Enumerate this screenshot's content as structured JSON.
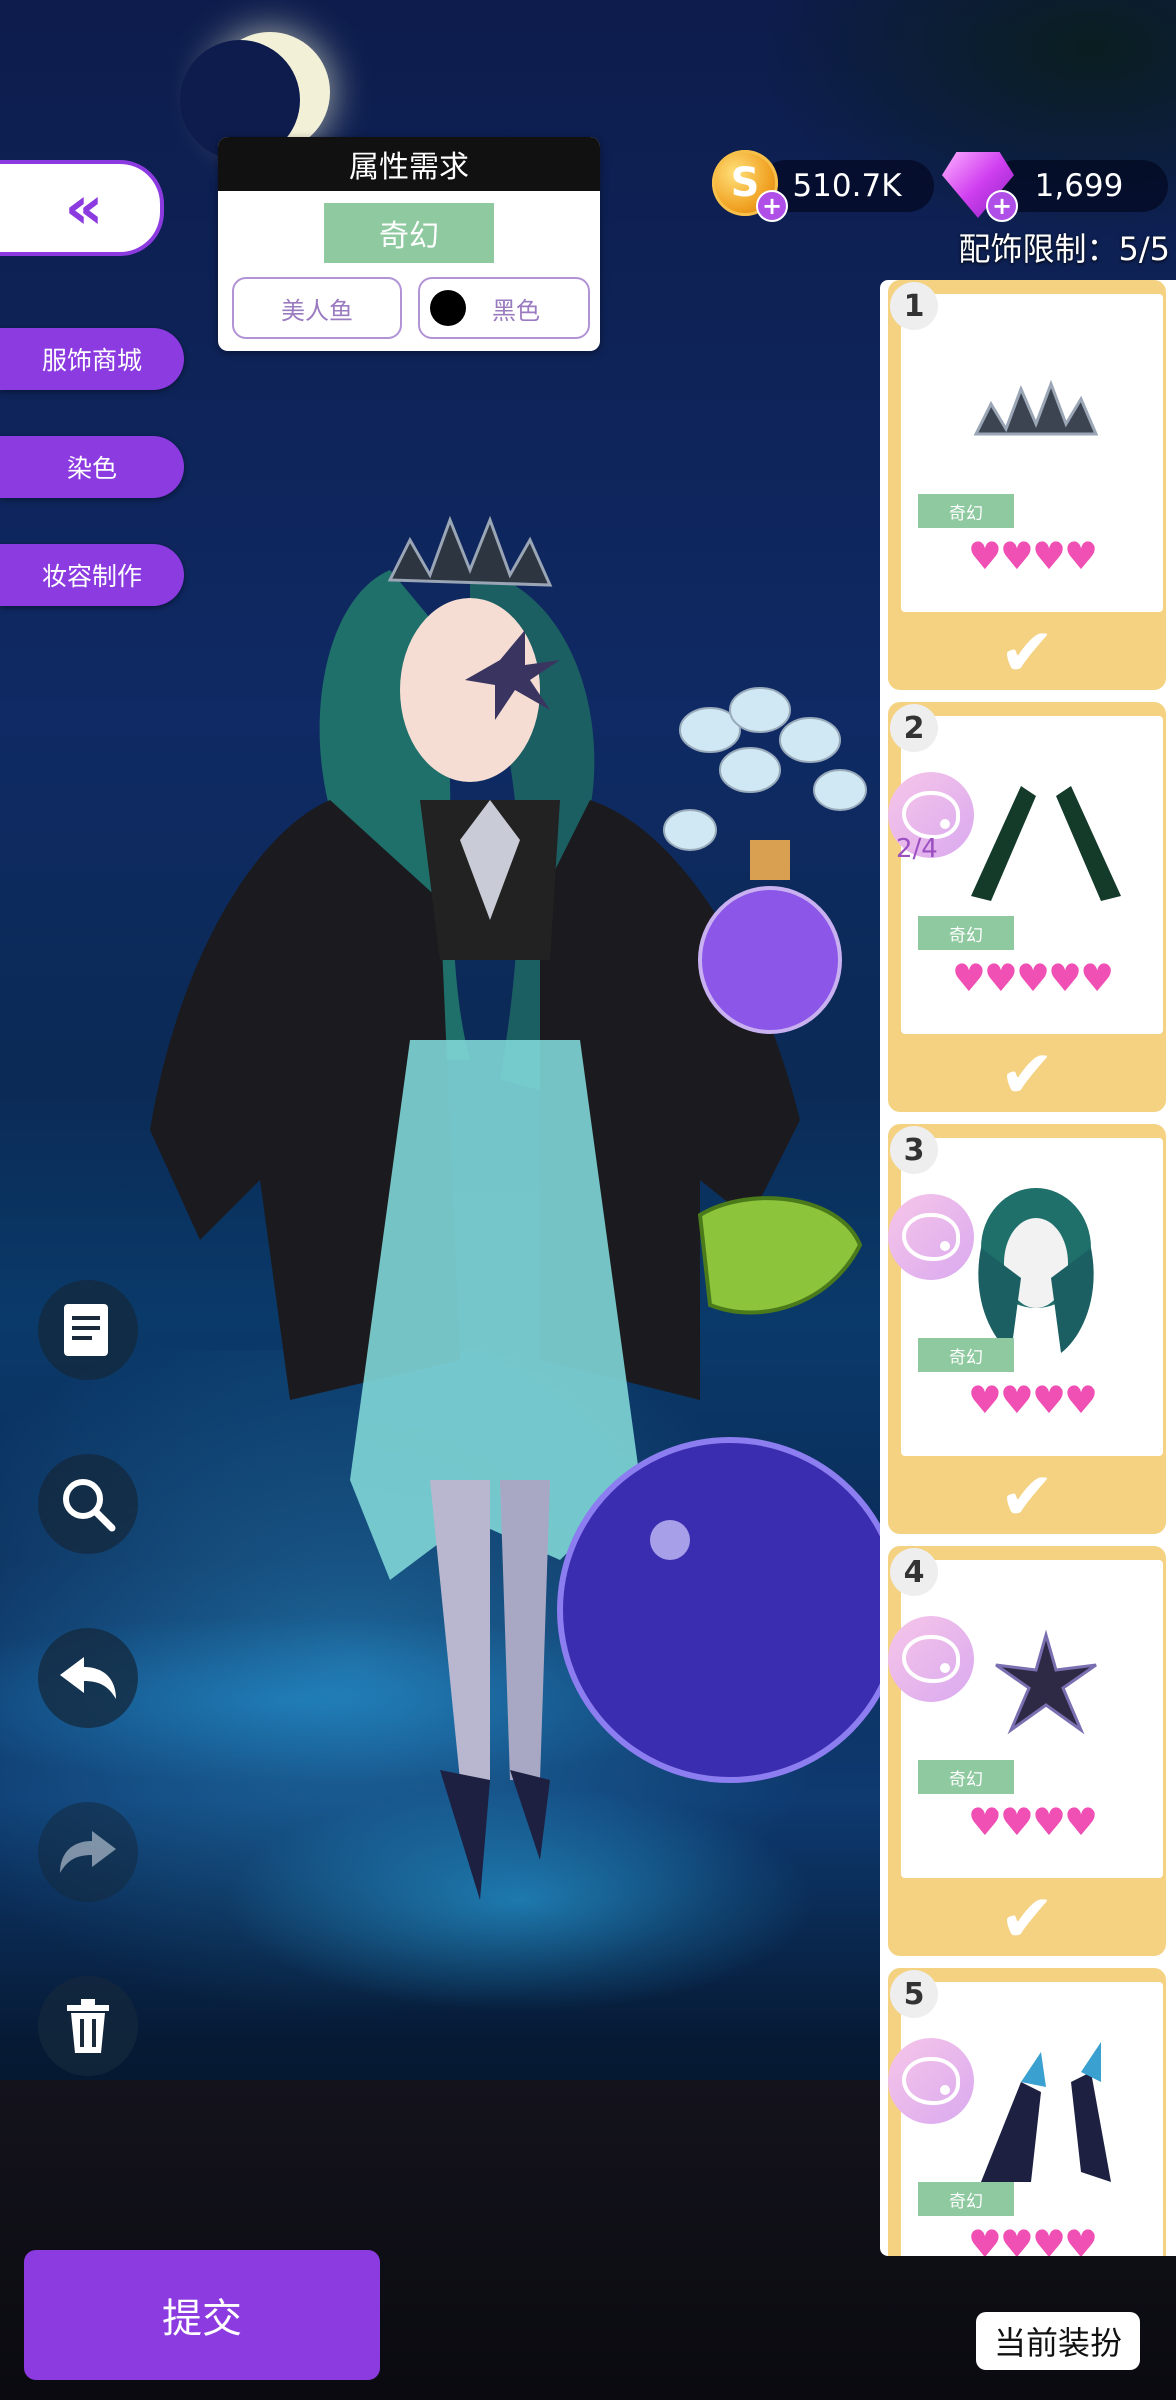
{
  "requirements": {
    "title": "属性需求",
    "style": "奇幻",
    "tags": [
      "美人鱼",
      "黑色"
    ],
    "color_hex": "#000000"
  },
  "currency": {
    "coins": "510.7K",
    "coin_symbol": "S",
    "gems": "1,699",
    "plus": "+"
  },
  "limit_text": "配饰限制：5/5",
  "left_menu": {
    "back_icon": "«",
    "items": [
      "服饰商城",
      "染色",
      "妆容制作"
    ]
  },
  "accessories": [
    {
      "num": "1",
      "style": "奇幻",
      "hearts": "♥♥♥♥",
      "dye": "",
      "checked": true,
      "icon": "crown-icon"
    },
    {
      "num": "2",
      "style": "奇幻",
      "hearts": "♥♥♥♥♥",
      "dye": "2/4",
      "checked": true,
      "icon": "gloves-icon"
    },
    {
      "num": "3",
      "style": "奇幻",
      "hearts": "♥♥♥♥",
      "dye": "",
      "checked": true,
      "icon": "hair-icon"
    },
    {
      "num": "4",
      "style": "奇幻",
      "hearts": "♥♥♥♥",
      "dye": "",
      "checked": true,
      "icon": "flower-icon"
    },
    {
      "num": "5",
      "style": "奇幻",
      "hearts": "♥♥♥♥",
      "dye": "",
      "checked": false,
      "icon": "shoes-icon"
    }
  ],
  "check_glyph": "✔",
  "tools": [
    "notes-icon",
    "magnify-icon",
    "undo-icon",
    "redo-icon",
    "trash-icon"
  ],
  "submit_label": "提交",
  "current_outfit_label": "当前装扮"
}
